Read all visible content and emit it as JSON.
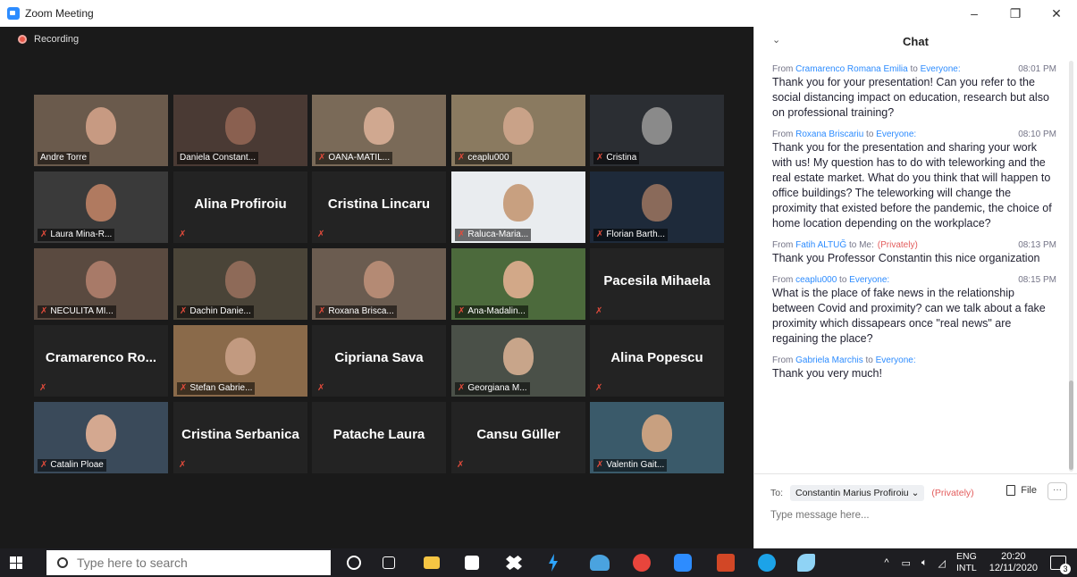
{
  "window": {
    "title": "Zoom Meeting",
    "minimize": "–",
    "maximize": "❐",
    "close": "✕"
  },
  "meeting": {
    "recording_label": "Recording"
  },
  "tiles": [
    {
      "name": "Andre Torre",
      "big": false,
      "muted": false,
      "active": true
    },
    {
      "name": "Daniela Constant...",
      "big": false,
      "muted": false
    },
    {
      "name": "OANA-MATIL...",
      "big": false,
      "muted": true
    },
    {
      "name": "ceaplu000",
      "big": false,
      "muted": true
    },
    {
      "name": "Cristina",
      "big": false,
      "muted": true
    },
    {
      "name": "Laura Mina-R...",
      "big": false,
      "muted": true
    },
    {
      "name": "Alina Profiroiu",
      "big": true,
      "muted": true
    },
    {
      "name": "Cristina Lincaru",
      "big": true,
      "muted": true
    },
    {
      "name": "Raluca-Maria...",
      "big": false,
      "muted": true
    },
    {
      "name": "Florian Barth...",
      "big": false,
      "muted": true
    },
    {
      "name": "NECULITA MI...",
      "big": false,
      "muted": true
    },
    {
      "name": "Dachin Danie...",
      "big": false,
      "muted": true
    },
    {
      "name": "Roxana Brisca...",
      "big": false,
      "muted": true
    },
    {
      "name": "Ana-Madalin...",
      "big": false,
      "muted": true
    },
    {
      "name": "Pacesila Mihaela",
      "big": true,
      "muted": true
    },
    {
      "name": "Cramarenco Ro...",
      "big": true,
      "muted": true
    },
    {
      "name": "Stefan Gabrie...",
      "big": false,
      "muted": true
    },
    {
      "name": "Cipriana Sava",
      "big": true,
      "muted": true
    },
    {
      "name": "Georgiana M...",
      "big": false,
      "muted": true
    },
    {
      "name": "Alina Popescu",
      "big": true,
      "muted": true
    },
    {
      "name": "Catalin Ploae",
      "big": false,
      "muted": true
    },
    {
      "name": "Cristina Serbanica",
      "big": true,
      "muted": true
    },
    {
      "name": "Patache Laura",
      "big": true,
      "muted": false
    },
    {
      "name": "Cansu Güller",
      "big": true,
      "muted": true
    },
    {
      "name": "Valentin Gait...",
      "big": false,
      "muted": true
    }
  ],
  "chat": {
    "title": "Chat",
    "messages": [
      {
        "from": "Cramarenco Romana Emilia",
        "to": "Everyone",
        "private": "",
        "time": "08:01 PM",
        "text": "Thank you for your presentation! Can you refer to the social distancing impact on education, research but also on professional training?"
      },
      {
        "from": "Roxana Briscariu",
        "to": "Everyone",
        "private": "",
        "time": "08:10 PM",
        "text": "Thank you for the presentation and sharing your work with us! My question has to do with teleworking and the real estate market. What do you think that will happen to office buildings? The teleworking will change the proximity that existed before the pandemic, the choice of home location depending on the workplace?"
      },
      {
        "from": "Fatih ALTUĞ",
        "to": "Me",
        "private": "(Privately)",
        "time": "08:13 PM",
        "text": "Thank you Professor Constantin this  nice organization"
      },
      {
        "from": "ceaplu000",
        "to": "Everyone",
        "private": "",
        "time": "08:15 PM",
        "text": "What is the place of fake news in the relationship between Covid and proximity? can we talk about a fake proximity which dissapears once \"real news\" are regaining the place?"
      },
      {
        "from": "Gabriela Marchis",
        "to": "Everyone",
        "private": "",
        "time": "",
        "text": "Thank you very much!"
      }
    ],
    "to_label": "To:",
    "to_value": "Constantin Marius Profiroiu",
    "to_private": "(Privately)",
    "file_label": "File",
    "more_label": "···",
    "input_placeholder": "Type message here..."
  },
  "taskbar": {
    "search_placeholder": "Type here to search",
    "lang_top": "ENG",
    "lang_bottom": "INTL",
    "time": "20:20",
    "date": "12/11/2020",
    "notifications": "3"
  }
}
